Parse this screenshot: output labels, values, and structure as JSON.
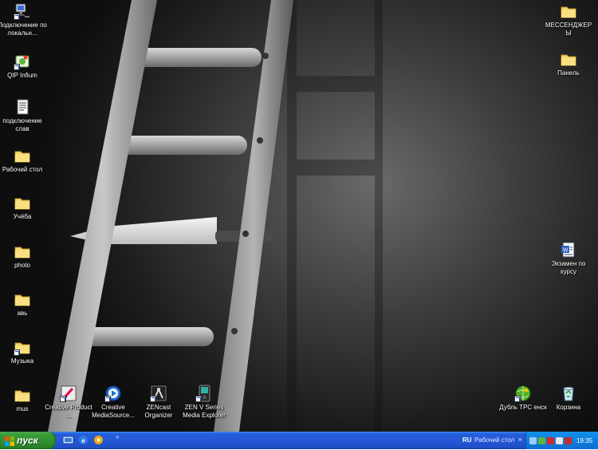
{
  "desktop": {
    "icons_left": [
      {
        "label": "Подключение по локальн...",
        "icon": "network-connection-icon"
      },
      {
        "label": "QIP Infium",
        "icon": "qip-icon"
      },
      {
        "label": "подключение слав",
        "icon": "document-icon"
      },
      {
        "label": "Рабочий стол",
        "icon": "folder-icon"
      },
      {
        "label": "Учёба",
        "icon": "folder-icon"
      },
      {
        "label": "photo",
        "icon": "folder-icon"
      },
      {
        "label": "авь",
        "icon": "folder-icon"
      },
      {
        "label": "Музыка",
        "icon": "folder-shortcut-icon"
      },
      {
        "label": "mus",
        "icon": "folder-icon"
      }
    ],
    "icons_bottom": [
      {
        "label": "Creative Product ...",
        "icon": "creative-product-icon"
      },
      {
        "label": "Creative MediaSource...",
        "icon": "mediasource-icon"
      },
      {
        "label": "ZENcast Organizer",
        "icon": "zencast-icon"
      },
      {
        "label": "ZEN V Series Media Explorer",
        "icon": "zen-explorer-icon"
      }
    ],
    "icons_right": [
      {
        "label": "МЕССЕНДЖЕРЫ",
        "icon": "folder-icon"
      },
      {
        "label": "Панель",
        "icon": "folder-icon"
      },
      {
        "label": "Экзамен по курсу",
        "icon": "word-document-icon"
      },
      {
        "label": "Дубль ТРС енск",
        "icon": "globe-shortcut-icon"
      },
      {
        "label": "Корзина",
        "icon": "recycle-bin-icon"
      }
    ]
  },
  "taskbar": {
    "start_label": "пуск",
    "language": "RU",
    "toolbar_label": "Рабочий стол",
    "clock": "19:35",
    "colors": {
      "taskbar": "#245edb",
      "start": "#3a9d3a",
      "tray": "#0f7fe0"
    }
  }
}
